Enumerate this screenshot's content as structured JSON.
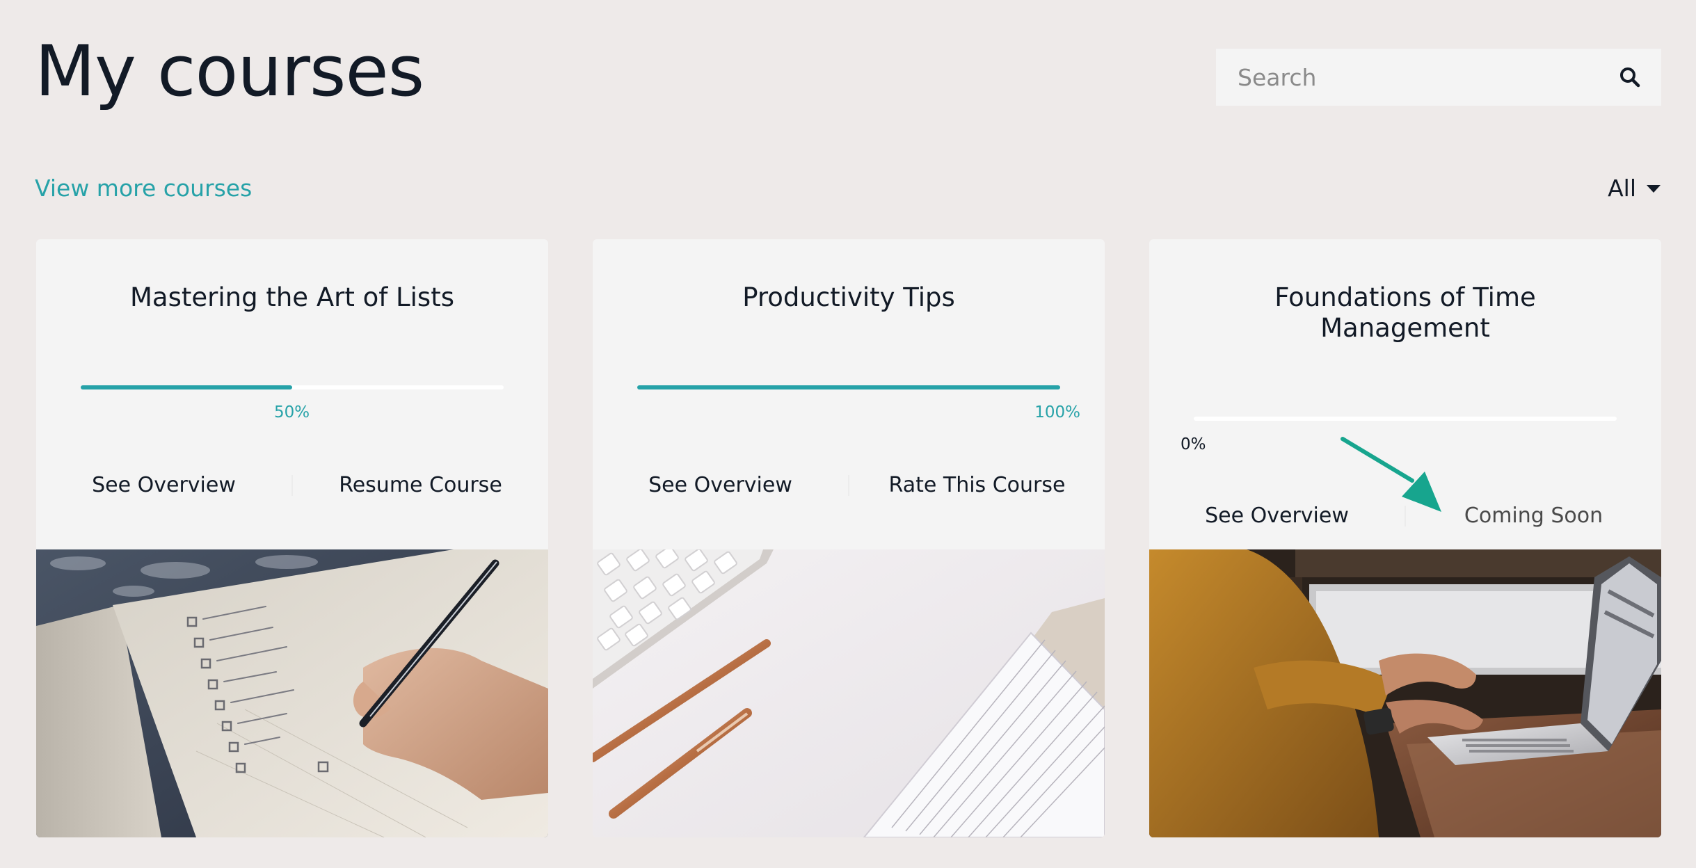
{
  "page": {
    "title": "My courses",
    "view_more_label": "View more courses"
  },
  "search": {
    "placeholder": "Search",
    "icon": "search-icon"
  },
  "filter": {
    "selected": "All",
    "icon": "caret-down-icon"
  },
  "colors": {
    "accent": "#26a2a8",
    "arrow": "#17a58e",
    "background": "#eeeae9",
    "card": "#f4f4f4",
    "text": "#121a26"
  },
  "courses": [
    {
      "title": "Mastering the Art of Lists",
      "progress_label": "50%",
      "progress": 0.5,
      "actions": [
        "See Overview",
        "Resume Course"
      ],
      "image": "notebook-checklist-photo"
    },
    {
      "title": "Productivity Tips",
      "progress_label": "100%",
      "progress": 1.0,
      "actions": [
        "See Overview",
        "Rate This Course"
      ],
      "image": "keyboard-pens-notepad-photo"
    },
    {
      "title": "Foundations of Time Management",
      "progress_label": "0%",
      "progress": 0,
      "actions": [
        "See Overview",
        "Coming Soon"
      ],
      "image": "person-typing-laptop-photo"
    }
  ],
  "annotation": {
    "type": "arrow",
    "points_to": "Coming Soon"
  }
}
